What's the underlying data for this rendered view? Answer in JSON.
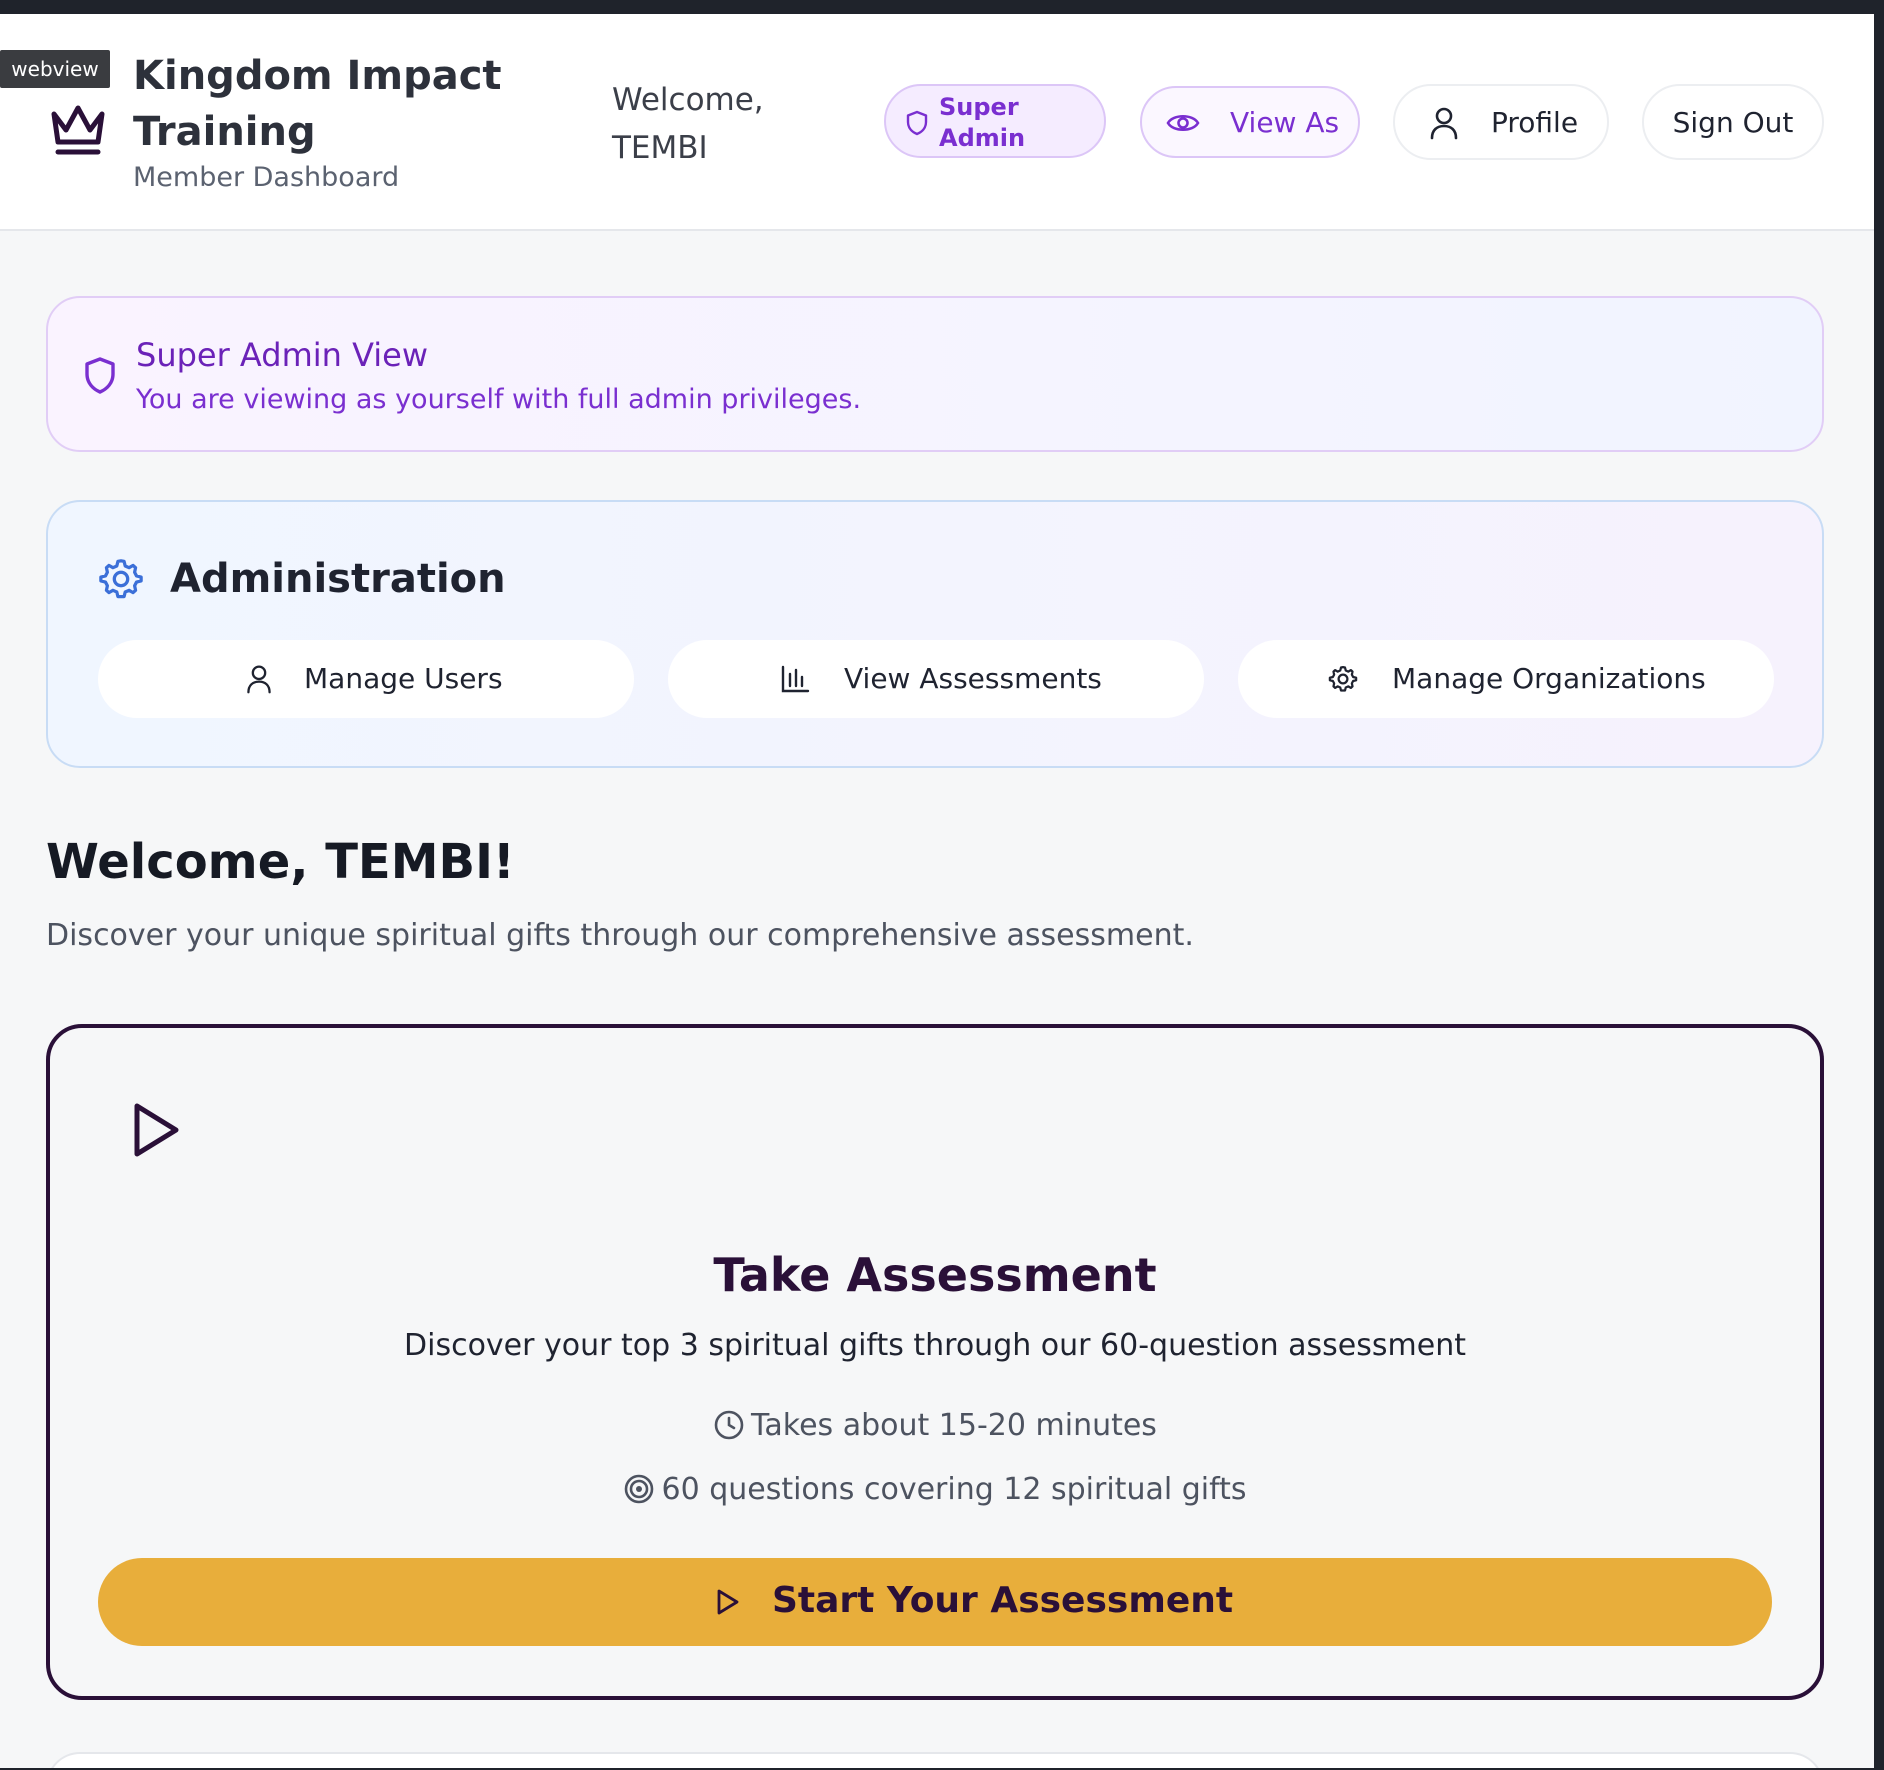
{
  "overlay": {
    "webview_label": "webview"
  },
  "header": {
    "app_title": "Kingdom Impact Training",
    "app_subtitle": "Member Dashboard",
    "welcome_text": "Welcome, TEMBI",
    "role_badge": "Super Admin",
    "view_as_label": "View As",
    "profile_label": "Profile",
    "sign_out_label": "Sign Out",
    "icons": [
      "crown-icon",
      "shield-icon",
      "eye-icon",
      "user-icon"
    ]
  },
  "notice": {
    "title": "Super Admin View",
    "description": "You are viewing as yourself with full admin privileges."
  },
  "administration": {
    "title": "Administration",
    "buttons": [
      {
        "label": "Manage Users",
        "icon": "user-icon"
      },
      {
        "label": "View Assessments",
        "icon": "bar-chart-icon"
      },
      {
        "label": "Manage Organizations",
        "icon": "gear-icon"
      }
    ]
  },
  "welcome": {
    "title": "Welcome, TEMBI!",
    "description": "Discover your unique spiritual gifts through our comprehensive assessment."
  },
  "assessment_card": {
    "title": "Take Assessment",
    "description": "Discover your top 3 spiritual gifts through our 60-question assessment",
    "duration": "Takes about 15-20 minutes",
    "questions": "60 questions covering 12 spiritual gifts",
    "cta_label": "Start Your Assessment"
  },
  "colors": {
    "accent_purple": "#7a2fd0",
    "dark_purple": "#2a1038",
    "cta_gold": "#e8ae3b",
    "admin_blue": "#3b6fd8"
  }
}
